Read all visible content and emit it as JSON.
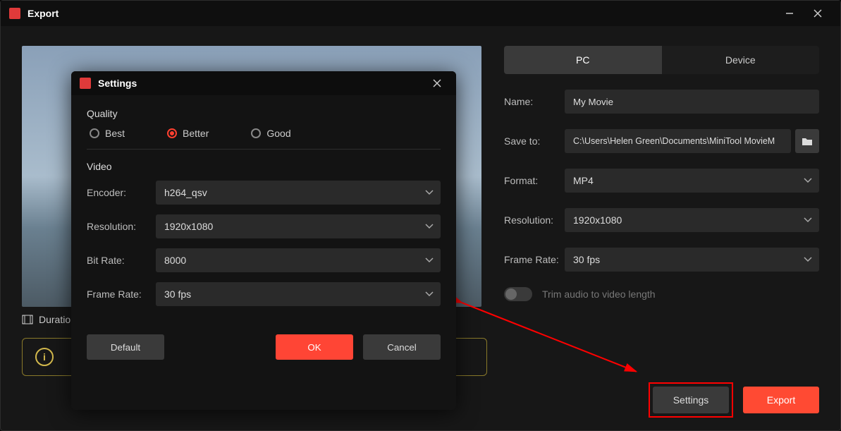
{
  "window": {
    "title": "Export"
  },
  "tabs": {
    "pc": "PC",
    "device": "Device"
  },
  "form": {
    "name_label": "Name:",
    "name_value": "My Movie",
    "saveto_label": "Save to:",
    "saveto_value": "C:\\Users\\Helen Green\\Documents\\MiniTool MovieM",
    "format_label": "Format:",
    "format_value": "MP4",
    "resolution_label": "Resolution:",
    "resolution_value": "1920x1080",
    "framerate_label": "Frame Rate:",
    "framerate_value": "30 fps",
    "trim_label": "Trim audio to video length"
  },
  "footer": {
    "settings": "Settings",
    "export": "Export"
  },
  "info": {
    "duration_label": "Duration"
  },
  "modal": {
    "title": "Settings",
    "quality": {
      "heading": "Quality",
      "best": "Best",
      "better": "Better",
      "good": "Good"
    },
    "video": {
      "heading": "Video",
      "encoder_label": "Encoder:",
      "encoder_value": "h264_qsv",
      "resolution_label": "Resolution:",
      "resolution_value": "1920x1080",
      "bitrate_label": "Bit Rate:",
      "bitrate_value": "8000",
      "framerate_label": "Frame Rate:",
      "framerate_value": "30 fps"
    },
    "buttons": {
      "default": "Default",
      "ok": "OK",
      "cancel": "Cancel"
    }
  }
}
